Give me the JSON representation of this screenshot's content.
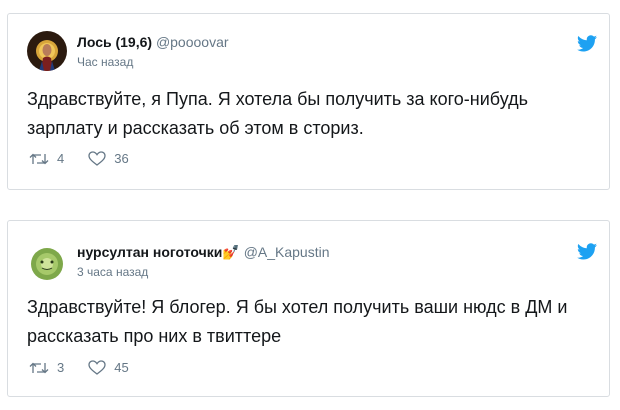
{
  "tweets": [
    {
      "display_name": "Лось (19,6)",
      "handle": "@poooovar",
      "time": "Час назад",
      "text": "Здравствуйте, я Пупа. Я хотела бы получить за кого-нибудь зарплату и рассказать об этом в сториз.",
      "retweets": "4",
      "likes": "36",
      "avatar_icon": "religious-icon-avatar"
    },
    {
      "display_name": "нурсултан ноготочки💅",
      "handle": "@A_Kapustin",
      "time": "3 часа назад",
      "text": "Здравствуйте! Я блогер. Я бы хотел получить ваши нюдс в ДМ и рассказать про них в твиттере",
      "retweets": "3",
      "likes": "45",
      "avatar_icon": "cabbage-avatar"
    }
  ],
  "colors": {
    "twitter_blue": "#1da1f2",
    "secondary_text": "#657786",
    "border": "#d9dde1"
  }
}
